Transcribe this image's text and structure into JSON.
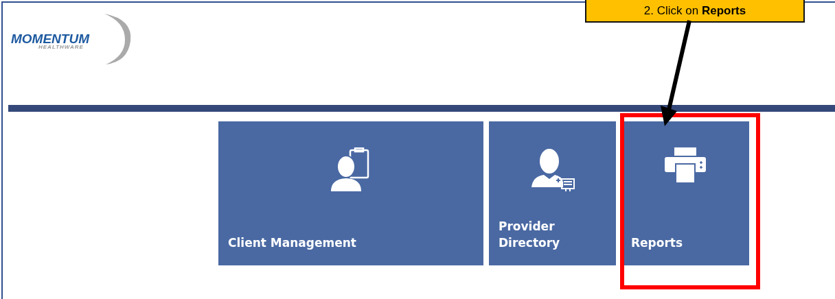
{
  "logo": {
    "name": "MOMENTUM",
    "tagline": "HEALTHWARE"
  },
  "tiles": [
    {
      "label": "Client Management",
      "kind": "client",
      "highlighted": false
    },
    {
      "label": "Provider Directory",
      "kind": "provider",
      "highlighted": false
    },
    {
      "label": "Reports",
      "kind": "printer",
      "highlighted": true
    }
  ],
  "callout": {
    "text": "2. Click on **Reports**"
  }
}
